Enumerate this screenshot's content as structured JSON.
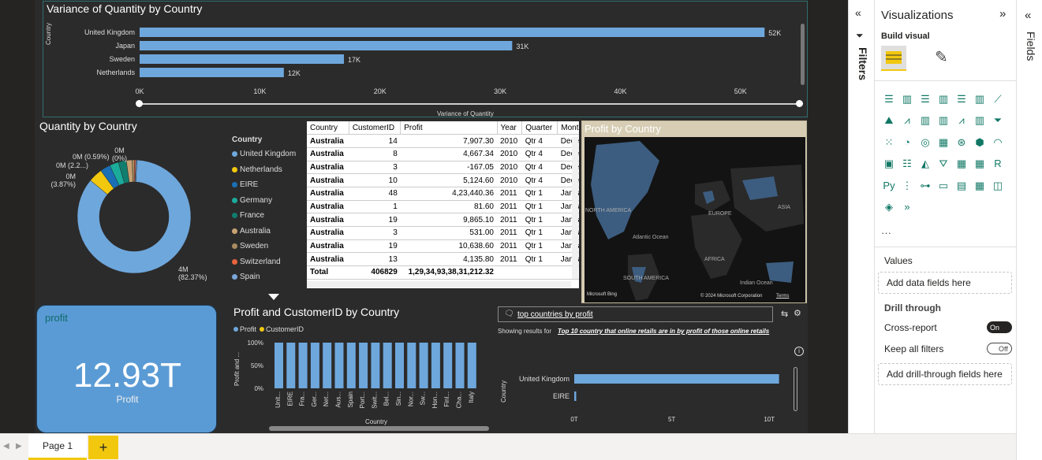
{
  "variance_chart": {
    "title": "Variance of Quantity by Country",
    "ylabel": "Country",
    "xlabel": "Variance of Quantity",
    "chart_data": {
      "type": "bar",
      "orientation": "horizontal",
      "categories": [
        "United Kingdom",
        "Japan",
        "Sweden",
        "Netherlands"
      ],
      "values": [
        52,
        31,
        17,
        12
      ],
      "data_labels": [
        "52K",
        "31K",
        "17K",
        "12K"
      ],
      "xticks": [
        "0K",
        "10K",
        "20K",
        "30K",
        "40K",
        "50K"
      ],
      "xlim": [
        0,
        55
      ],
      "color": "#6ea7dc"
    }
  },
  "donut_chart": {
    "title": "Quantity by Country",
    "legend_title": "Country",
    "chart_data": {
      "type": "pie",
      "categories": [
        "United Kingdom",
        "Netherlands",
        "EIRE",
        "Germany",
        "France",
        "Australia",
        "Sweden",
        "Switzerland",
        "Spain"
      ],
      "values": [
        82.37,
        3.87,
        2.8,
        2.5,
        2.2,
        1.6,
        0.59,
        0.4,
        0.3
      ],
      "colors": [
        "#6ea7dc",
        "#f2c80f",
        "#1a6fb5",
        "#1aab9b",
        "#107d6e",
        "#c8a273",
        "#a88c60",
        "#e8643c",
        "#7aa6d8"
      ],
      "labels": [
        "4M\n(82.37%)",
        "0M\n(3.87%)",
        "0M (2.2...)",
        "0M (0.59%)",
        "0M\n(0%)"
      ]
    },
    "label_main": "4M",
    "label_main_pct": "(82.37%)",
    "label_a": "0M",
    "label_a_pct": "(3.87%)",
    "label_b": "0M (2.2...)",
    "label_c": "0M (0.59%)",
    "label_d": "0M",
    "label_d_pct": "(0%)"
  },
  "table": {
    "columns": [
      "Country",
      "CustomerID",
      "Profit",
      "Year",
      "Quarter",
      "Month"
    ],
    "rows": [
      [
        "Australia",
        "14",
        "7,907.30",
        "2010",
        "Qtr 4",
        "Decem"
      ],
      [
        "Australia",
        "8",
        "4,667.34",
        "2010",
        "Qtr 4",
        "Decem"
      ],
      [
        "Australia",
        "3",
        "-167.05",
        "2010",
        "Qtr 4",
        "Decem"
      ],
      [
        "Australia",
        "10",
        "5,124.60",
        "2010",
        "Qtr 4",
        "Decem"
      ],
      [
        "Australia",
        "48",
        "4,23,440.36",
        "2011",
        "Qtr 1",
        "Janua"
      ],
      [
        "Australia",
        "1",
        "81.60",
        "2011",
        "Qtr 1",
        "Janua"
      ],
      [
        "Australia",
        "19",
        "9,865.10",
        "2011",
        "Qtr 1",
        "Janua"
      ],
      [
        "Australia",
        "3",
        "531.00",
        "2011",
        "Qtr 1",
        "Janua"
      ],
      [
        "Australia",
        "19",
        "10,638.60",
        "2011",
        "Qtr 1",
        "Janua"
      ],
      [
        "Australia",
        "13",
        "4,135.80",
        "2011",
        "Qtr 1",
        "Janua"
      ]
    ],
    "total_label": "Total",
    "total_customer": "406829",
    "total_profit": "1,29,34,93,38,31,212.32"
  },
  "map": {
    "title": "Profit by Country",
    "labels": [
      "NORTH AMERICA",
      "EUROPE",
      "ASIA",
      "Atlantic Ocean",
      "AFRICA",
      "SOUTH AMERICA",
      "Indian Ocean"
    ],
    "bing": "Microsoft Bing",
    "copyright": "© 2024 Microsoft Corporation",
    "terms": "Terms"
  },
  "card": {
    "title": "profit",
    "value": "12.93T",
    "label": "Profit"
  },
  "column_chart": {
    "title": "Profit and CustomerID by Country",
    "legend": [
      "Profit",
      "CustomerID"
    ],
    "legend_colors": [
      "#6ea7dc",
      "#f2c80f"
    ],
    "ylabel": "Profit and ...",
    "xlabel": "Country",
    "chart_data": {
      "type": "bar",
      "categories": [
        "Unit...",
        "EIRE",
        "Fra...",
        "Ger...",
        "Net...",
        "Aus...",
        "Spain",
        "Port...",
        "Swit...",
        "Bel...",
        "Sin...",
        "Nor...",
        "Sw...",
        "Hon...",
        "Finl...",
        "Cha...",
        "Italy"
      ],
      "series": [
        {
          "name": "Profit",
          "values": [
            100,
            100,
            100,
            100,
            100,
            100,
            100,
            100,
            100,
            100,
            100,
            100,
            100,
            100,
            100,
            100,
            100
          ]
        }
      ],
      "yticks": [
        "100%",
        "50%",
        "0%"
      ],
      "ylim": [
        0,
        100
      ]
    }
  },
  "qa": {
    "query": "top countries by profit",
    "showing": "Showing results for",
    "result_link": "Top 10 country that online retails are in by profit of those online retails",
    "ylabel": "Country",
    "chart_data": {
      "type": "bar",
      "orientation": "horizontal",
      "categories": [
        "United Kingdom",
        "EIRE"
      ],
      "values": [
        10.5,
        0.1
      ],
      "xticks": [
        "0T",
        "5T",
        "10T"
      ],
      "xlim": [
        0,
        11
      ]
    }
  },
  "filters_label": "Filters",
  "viz_pane": {
    "title": "Visualizations",
    "build_visual": "Build visual",
    "values_label": "Values",
    "add_data": "Add data fields here",
    "drill_through": "Drill through",
    "cross_report": "Cross-report",
    "cross_report_state": "On",
    "keep_filters": "Keep all filters",
    "keep_filters_state": "Off",
    "add_drill": "Add drill-through fields here",
    "more": "···"
  },
  "fields_label": "Fields",
  "pages": {
    "tab": "Page 1",
    "add": "+"
  }
}
